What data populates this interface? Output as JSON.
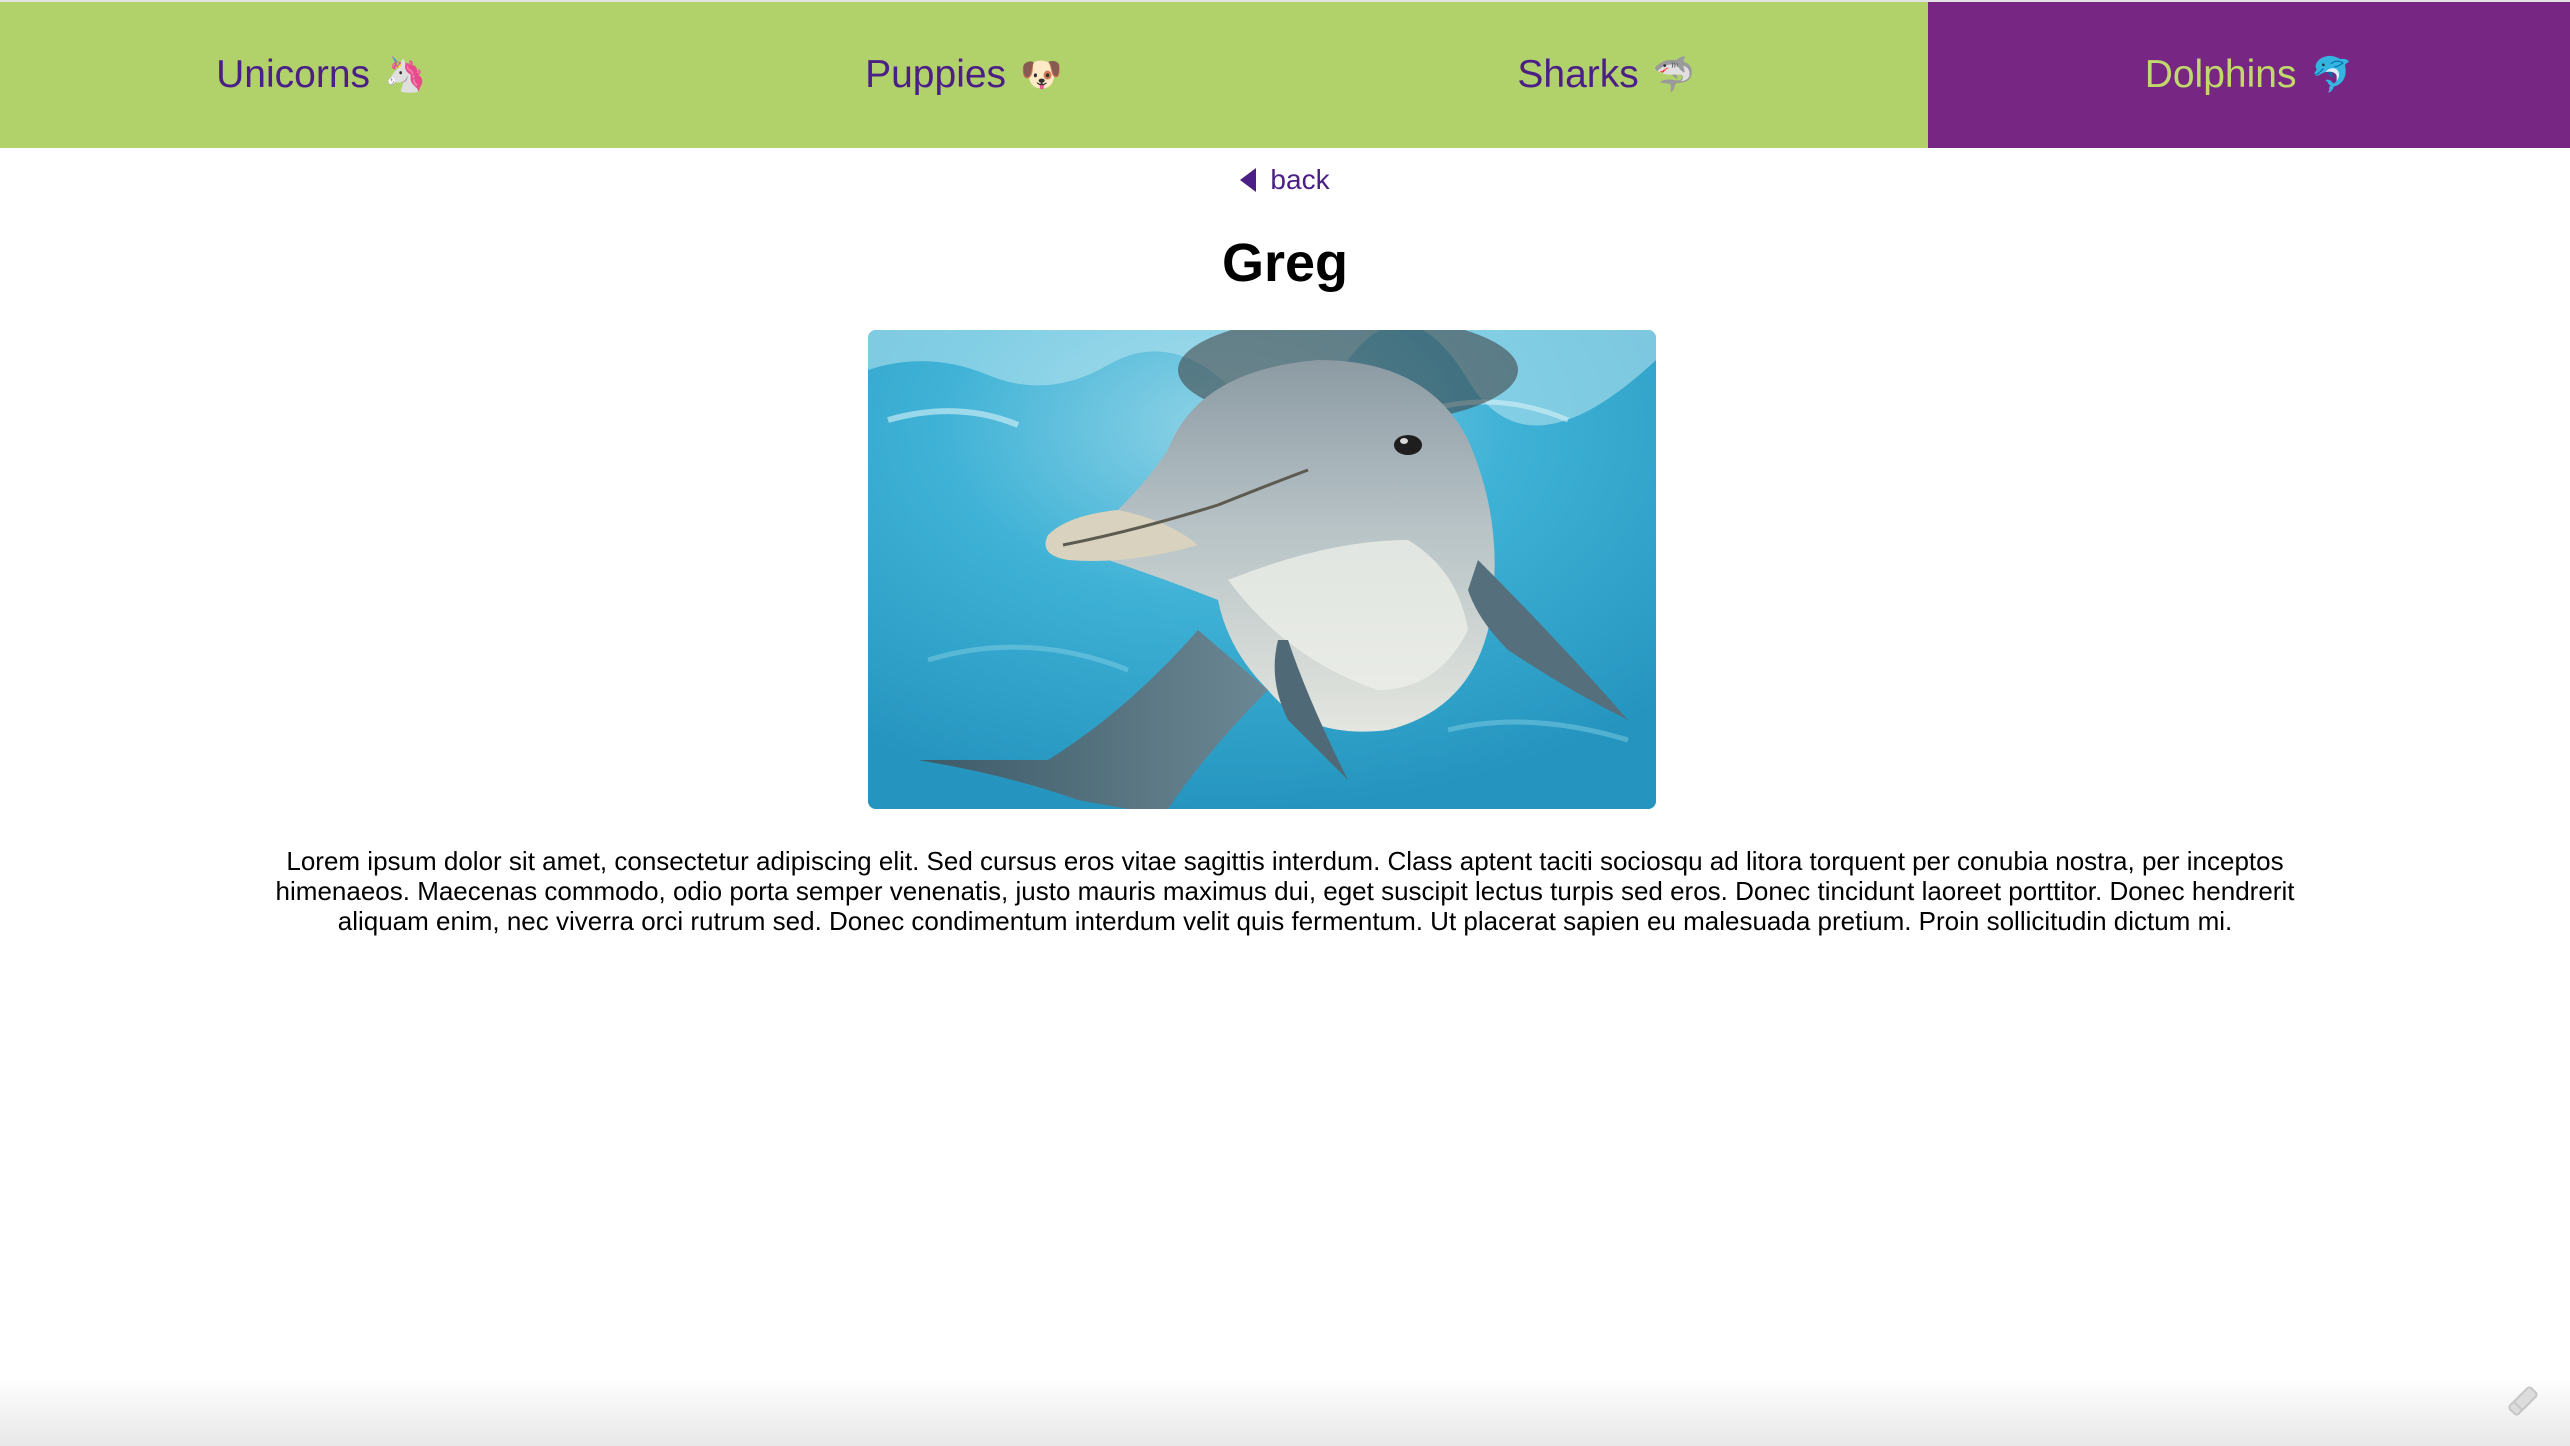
{
  "nav": {
    "tabs": [
      {
        "label": "Unicorns",
        "emoji": "🦄",
        "icon": "unicorn-icon",
        "active": false
      },
      {
        "label": "Puppies",
        "emoji": "🐶",
        "icon": "puppy-icon",
        "active": false
      },
      {
        "label": "Sharks",
        "emoji": "🦈",
        "icon": "shark-icon",
        "active": false
      },
      {
        "label": "Dolphins",
        "emoji": "🐬",
        "icon": "dolphin-icon",
        "active": true
      }
    ]
  },
  "back": {
    "label": "back",
    "icon": "caret-left-icon"
  },
  "detail": {
    "title": "Greg",
    "image_alt": "dolphin",
    "description": "Lorem ipsum dolor sit amet, consectetur adipiscing elit. Sed cursus eros vitae sagittis interdum. Class aptent taciti sociosqu ad litora torquent per conubia nostra, per inceptos himenaeos. Maecenas commodo, odio porta semper venenatis, justo mauris maximus dui, eget suscipit lectus turpis sed eros. Donec tincidunt laoreet porttitor. Donec hendrerit aliquam enim, nec viverra orci rutrum sed. Donec condimentum interdum velit quis fermentum. Ut placerat sapien eu malesuada pretium. Proin sollicitudin dictum mi."
  },
  "colors": {
    "nav_bg": "#b1d16a",
    "nav_active_bg": "#782683",
    "nav_text": "#4b1f85",
    "nav_active_text": "#c1d96c"
  },
  "corner": {
    "icon": "feedback-pencil-icon"
  }
}
